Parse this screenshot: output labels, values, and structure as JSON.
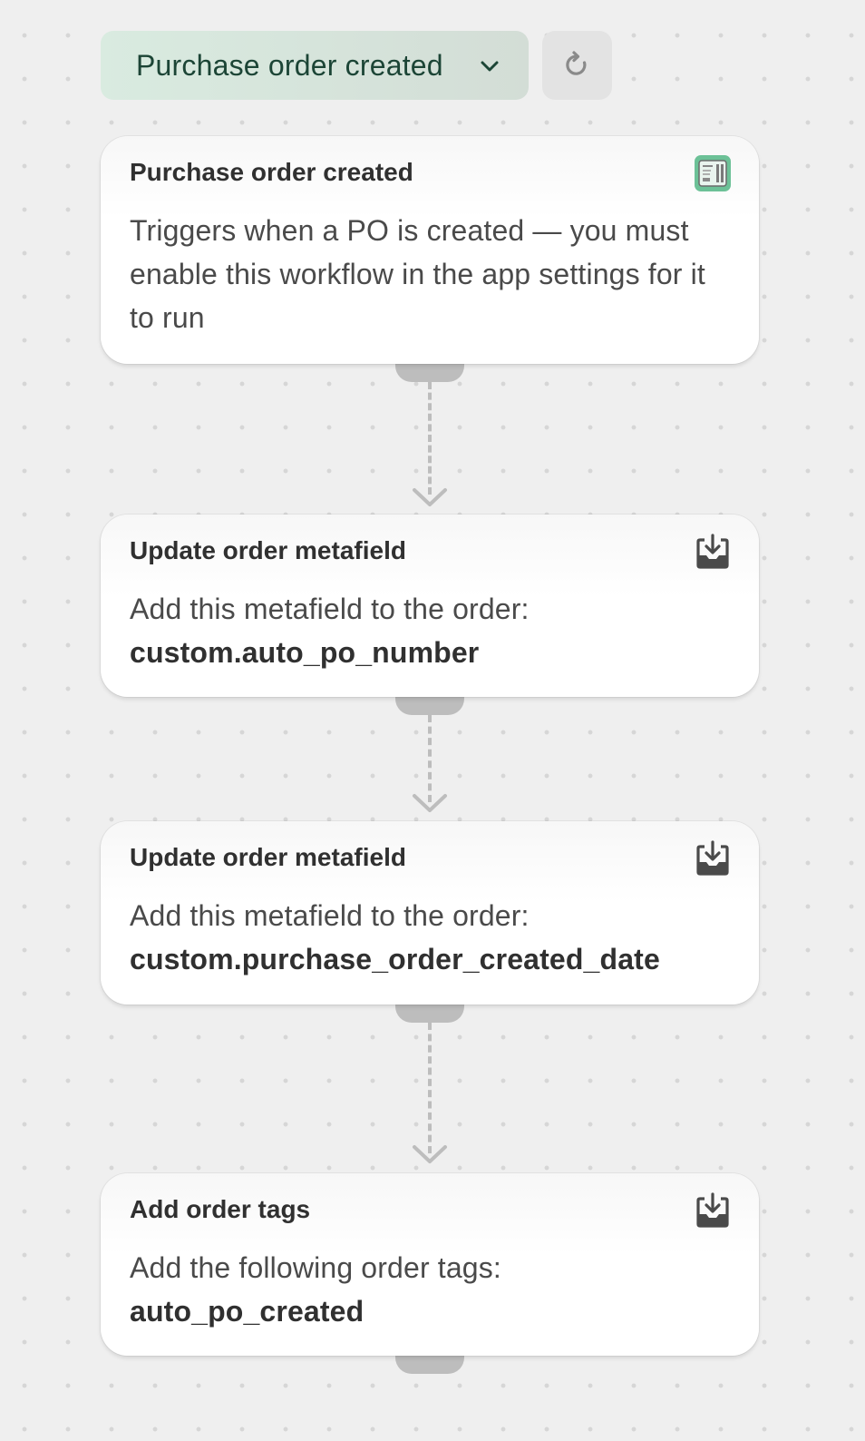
{
  "toolbar": {
    "trigger_select_label": "Purchase order created",
    "chevron_icon": "chevron-down-icon",
    "refresh_icon": "refresh-icon"
  },
  "steps": [
    {
      "title": "Purchase order created",
      "icon": "purchase-order-app-icon",
      "description": "Triggers when a PO is created — you must enable this workflow in the app settings for it to run",
      "value": ""
    },
    {
      "title": "Update order metafield",
      "icon": "download-icon",
      "description": "Add this metafield to the order:",
      "value": "custom.auto_po_number"
    },
    {
      "title": "Update order metafield",
      "icon": "download-icon",
      "description": "Add this metafield to the order:",
      "value": "custom.purchase_order_created_date"
    },
    {
      "title": "Add order tags",
      "icon": "download-icon",
      "description": "Add the following order tags:",
      "value": "auto_po_created"
    }
  ],
  "colors": {
    "trigger_bg": "#d9ebe0",
    "trigger_text": "#1c4536",
    "connector": "#bdbdbd",
    "canvas": "#efefef",
    "app_icon": "#6cc197"
  }
}
